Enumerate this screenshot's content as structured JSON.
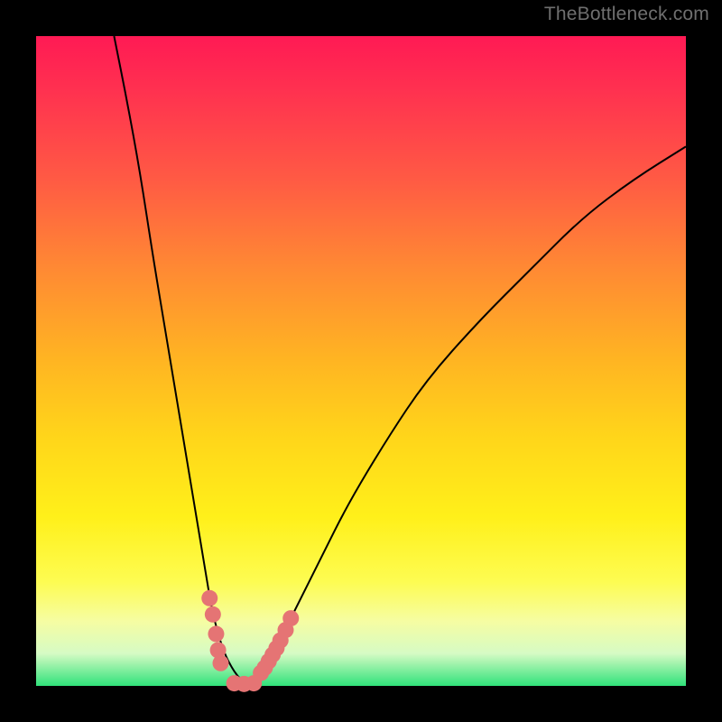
{
  "watermark": "TheBottleneck.com",
  "chart_data": {
    "type": "line",
    "title": "",
    "xlabel": "",
    "ylabel": "",
    "xlim": [
      0,
      100
    ],
    "ylim": [
      0,
      100
    ],
    "grid": false,
    "legend": false,
    "series": [
      {
        "name": "bottleneck-curve-left",
        "x": [
          12,
          14,
          16,
          18,
          20,
          22,
          24,
          26,
          27,
          28,
          29,
          30,
          31,
          32
        ],
        "values": [
          100,
          90,
          79,
          66,
          54,
          42,
          30,
          18,
          12,
          8,
          5,
          3,
          1.5,
          0.5
        ]
      },
      {
        "name": "bottleneck-curve-right",
        "x": [
          33,
          34,
          36,
          38,
          40,
          44,
          48,
          54,
          60,
          68,
          76,
          84,
          92,
          100
        ],
        "values": [
          0.5,
          1.5,
          4,
          8,
          12,
          20,
          28,
          38,
          47,
          56,
          64,
          72,
          78,
          83
        ]
      },
      {
        "name": "highlight-markers-left",
        "x": [
          26.7,
          27.2,
          27.7,
          28.0,
          28.4
        ],
        "values": [
          13.5,
          11.0,
          8.0,
          5.5,
          3.5
        ]
      },
      {
        "name": "highlight-markers-right",
        "x": [
          34.6,
          35.2,
          35.8,
          36.4,
          37.0,
          37.6,
          38.4,
          39.2
        ],
        "values": [
          2.0,
          2.8,
          3.8,
          4.8,
          5.8,
          7.0,
          8.6,
          10.4
        ]
      },
      {
        "name": "highlight-markers-bottom",
        "x": [
          30.5,
          32.0,
          33.5
        ],
        "values": [
          0.4,
          0.3,
          0.4
        ]
      }
    ],
    "background_gradient_stops": [
      {
        "pos": 0,
        "color": "#ff1a54"
      },
      {
        "pos": 22,
        "color": "#ff5a44"
      },
      {
        "pos": 50,
        "color": "#ffb522"
      },
      {
        "pos": 74,
        "color": "#fff01a"
      },
      {
        "pos": 90,
        "color": "#f6fda2"
      },
      {
        "pos": 100,
        "color": "#30e27a"
      }
    ],
    "marker_color": "#e57474",
    "curve_color": "#000000"
  }
}
